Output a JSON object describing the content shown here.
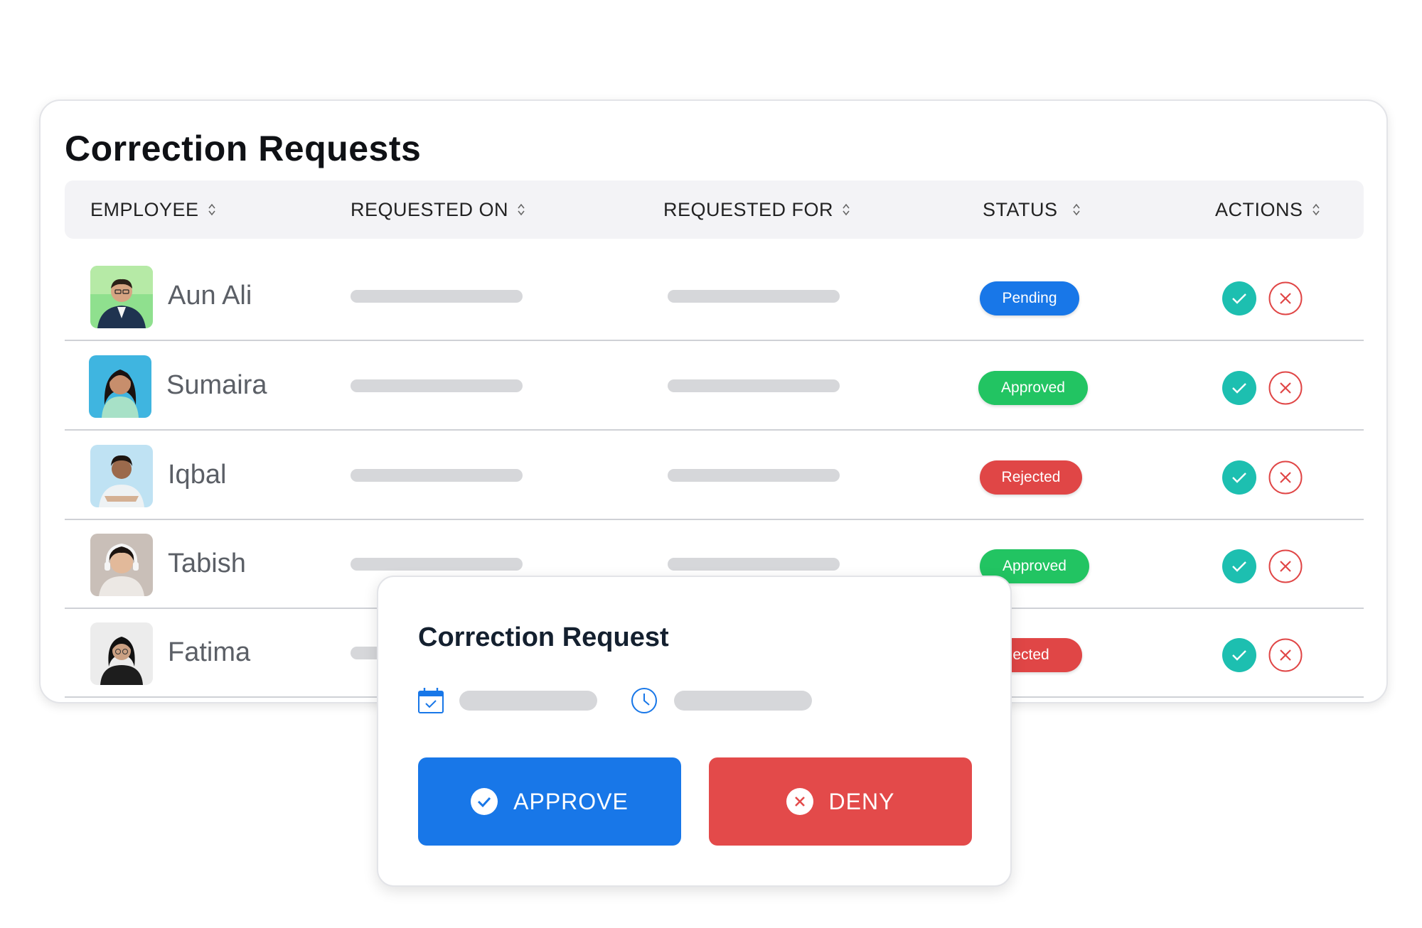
{
  "title": "Correction Requests",
  "columns": {
    "employee": "EMPLOYEE",
    "requested_on": "REQUESTED ON",
    "requested_for": "REQUESTED FOR",
    "status": "STATUS",
    "actions": "ACTIONS"
  },
  "rows": [
    {
      "name": "Aun Ali",
      "status": "Pending"
    },
    {
      "name": "Sumaira",
      "status": "Approved"
    },
    {
      "name": "Iqbal",
      "status": "Rejected"
    },
    {
      "name": "Tabish",
      "status": "Approved"
    },
    {
      "name": "Fatima",
      "status": "ected"
    }
  ],
  "modal": {
    "title": "Correction Request",
    "approve_label": "APPROVE",
    "deny_label": "DENY"
  },
  "icons": {
    "sort": "sort-icon",
    "approve": "check-circle-icon",
    "deny": "x-circle-icon",
    "date": "calendar-icon",
    "time": "clock-icon"
  },
  "colors": {
    "pending": "#1877e8",
    "approved": "#22c462",
    "rejected": "#e04646",
    "action_ok": "#1dbfb0",
    "action_no": "#e04646",
    "approve_button": "#1877e8",
    "deny_button": "#e34a4a"
  }
}
